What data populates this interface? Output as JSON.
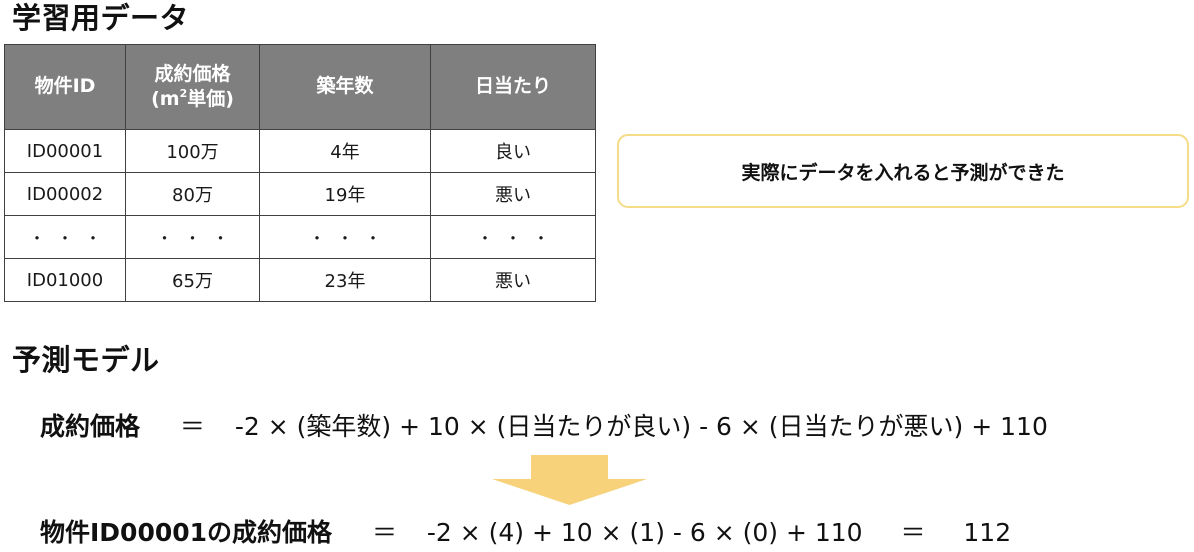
{
  "section_training": {
    "title": "学習用データ"
  },
  "table": {
    "headers": {
      "id": "物件ID",
      "price_line1": "成約価格",
      "price_line2_open": "(m",
      "price_line2_sup": "2",
      "price_line2_close": "単価)",
      "age": "築年数",
      "sunlight": "日当たり"
    },
    "rows": [
      {
        "id": "ID00001",
        "price": "100万",
        "age": "4年",
        "sunlight": "良い"
      },
      {
        "id": "ID00002",
        "price": "80万",
        "age": "19年",
        "sunlight": "悪い"
      },
      {
        "id": "・・・",
        "price": "・・・",
        "age": "・・・",
        "sunlight": "・・・"
      },
      {
        "id": "ID01000",
        "price": "65万",
        "age": "23年",
        "sunlight": "悪い"
      }
    ]
  },
  "callout": {
    "text": "実際にデータを入れると予測ができた"
  },
  "section_model": {
    "title": "予測モデル"
  },
  "formula_general": {
    "lhs": "成約価格",
    "equals": "＝",
    "rhs": "-2 × (築年数) + 10 × (日当たりが良い) - 6 × (日当たりが悪い) + 110"
  },
  "formula_applied": {
    "lhs": "物件ID00001の成約価格",
    "equals": "＝",
    "rhs": "-2 × (4) + 10 × (1) - 6 × (0) + 110",
    "equals2": "＝",
    "result": "112"
  },
  "colors": {
    "header_bg": "#7f7f7f",
    "callout_border": "#f5dc86",
    "arrow": "#f7d27a"
  },
  "icons": {
    "arrow": "down-arrow-icon"
  }
}
